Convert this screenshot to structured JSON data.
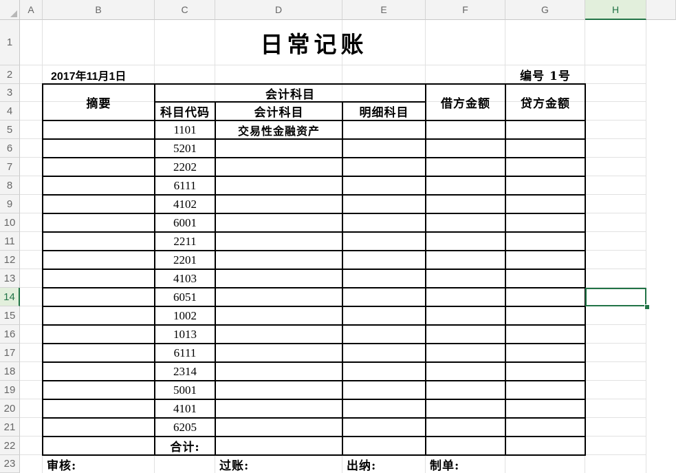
{
  "sheet": {
    "columns": [
      "A",
      "B",
      "C",
      "D",
      "E",
      "F",
      "G",
      "H",
      ""
    ],
    "rows": [
      "1",
      "2",
      "3",
      "4",
      "5",
      "6",
      "7",
      "8",
      "9",
      "10",
      "11",
      "12",
      "13",
      "14",
      "15",
      "16",
      "17",
      "18",
      "19",
      "20",
      "21",
      "22",
      "23"
    ],
    "selected_cell": {
      "column": "H",
      "row": "14"
    }
  },
  "doc": {
    "title": "日常记账",
    "date": "2017年11月1日",
    "voucher_no": "编号 1号",
    "header": {
      "summary": "摘要",
      "account_group": "会计科目",
      "code": "科目代码",
      "account": "会计科目",
      "detail": "明细科目",
      "debit": "借方金额",
      "credit": "贷方金额"
    },
    "entries": [
      {
        "code": "1101",
        "account": "交易性金融资产"
      },
      {
        "code": "5201",
        "account": ""
      },
      {
        "code": "2202",
        "account": ""
      },
      {
        "code": "6111",
        "account": ""
      },
      {
        "code": "4102",
        "account": ""
      },
      {
        "code": "6001",
        "account": ""
      },
      {
        "code": "2211",
        "account": ""
      },
      {
        "code": "2201",
        "account": ""
      },
      {
        "code": "4103",
        "account": ""
      },
      {
        "code": "6051",
        "account": ""
      },
      {
        "code": "1002",
        "account": ""
      },
      {
        "code": "1013",
        "account": ""
      },
      {
        "code": "6111",
        "account": ""
      },
      {
        "code": "2314",
        "account": ""
      },
      {
        "code": "5001",
        "account": ""
      },
      {
        "code": "4101",
        "account": ""
      },
      {
        "code": "6205",
        "account": ""
      }
    ],
    "total_label": "合计:",
    "footer": {
      "review": "审核:",
      "posting": "过账:",
      "cashier": "出纳:",
      "prepared": "制单:"
    }
  },
  "colors": {
    "accent": "#217346",
    "gridline": "#e1e1e1",
    "header_bg": "#f3f3f3"
  }
}
